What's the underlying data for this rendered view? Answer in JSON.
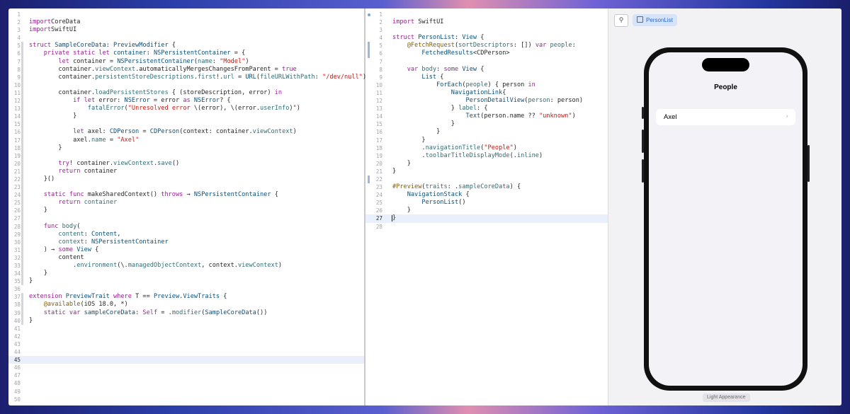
{
  "editor_left": {
    "current_line": 45,
    "lines": [
      [],
      [
        [
          "kw",
          "import"
        ],
        [
          "",
          "CoreData"
        ]
      ],
      [
        [
          "kw",
          "import"
        ],
        [
          "",
          "SwiftUI"
        ]
      ],
      [],
      [
        [
          "kw",
          "struct "
        ],
        [
          "ty",
          "SampleCoreData"
        ],
        [
          "",
          ": "
        ],
        [
          "ty",
          "PreviewModifier"
        ],
        [
          "",
          " {"
        ]
      ],
      [
        [
          "",
          "    "
        ],
        [
          "kw",
          "private static let "
        ],
        [
          "ty",
          "container"
        ],
        [
          "",
          ": "
        ],
        [
          "ty",
          "NSPersistentContainer"
        ],
        [
          "",
          " = {"
        ]
      ],
      [
        [
          "",
          "        "
        ],
        [
          "kw",
          "let "
        ],
        [
          "",
          "container = "
        ],
        [
          "ty",
          "NSPersistentContainer"
        ],
        [
          "",
          "("
        ],
        [
          "fn",
          "name"
        ],
        [
          "",
          ": "
        ],
        [
          "str",
          "\"Model\""
        ],
        [
          "",
          ")"
        ]
      ],
      [
        [
          "",
          "        container."
        ],
        [
          "fn",
          "viewContext"
        ],
        [
          "",
          ".automaticallyMergesChangesFromParent = "
        ],
        [
          "kw",
          "true"
        ]
      ],
      [
        [
          "",
          "        container."
        ],
        [
          "fn",
          "persistentStoreDescriptions"
        ],
        [
          "",
          "."
        ],
        [
          "fn",
          "first"
        ],
        [
          "",
          "!."
        ],
        [
          "fn",
          "url"
        ],
        [
          "",
          " = "
        ],
        [
          "ty",
          "URL"
        ],
        [
          "",
          "("
        ],
        [
          "fn",
          "fileURLWithPath"
        ],
        [
          "",
          ": "
        ],
        [
          "str",
          "\"/dev/null\""
        ],
        [
          "",
          ")"
        ]
      ],
      [],
      [
        [
          "",
          "        container."
        ],
        [
          "fn",
          "loadPersistentStores"
        ],
        [
          "",
          " { (storeDescription, error) "
        ],
        [
          "kw",
          "in"
        ]
      ],
      [
        [
          "",
          "            "
        ],
        [
          "kw",
          "if let "
        ],
        [
          "",
          "error: "
        ],
        [
          "ty",
          "NSError"
        ],
        [
          "",
          " = error "
        ],
        [
          "kw",
          "as "
        ],
        [
          "ty",
          "NSError"
        ],
        [
          "",
          "? {"
        ]
      ],
      [
        [
          "",
          "                "
        ],
        [
          "fn",
          "fatalError"
        ],
        [
          "",
          "("
        ],
        [
          "str",
          "\"Unresolved error "
        ],
        [
          "",
          "\\(error), \\(error."
        ],
        [
          "fn",
          "userInfo"
        ],
        [
          "",
          ")"
        ],
        [
          "str",
          "\""
        ],
        [
          "",
          ")"
        ]
      ],
      [
        [
          "",
          "            }"
        ]
      ],
      [],
      [
        [
          "",
          "            "
        ],
        [
          "kw",
          "let "
        ],
        [
          "",
          "axel: "
        ],
        [
          "ty",
          "CDPerson"
        ],
        [
          "",
          " = "
        ],
        [
          "ty",
          "CDPerson"
        ],
        [
          "",
          "(context: container."
        ],
        [
          "fn",
          "viewContext"
        ],
        [
          "",
          ")"
        ]
      ],
      [
        [
          "",
          "            axel."
        ],
        [
          "fn",
          "name"
        ],
        [
          "",
          " = "
        ],
        [
          "str",
          "\"Axel\""
        ]
      ],
      [
        [
          "",
          "        }"
        ]
      ],
      [],
      [
        [
          "",
          "        "
        ],
        [
          "kw",
          "try"
        ],
        [
          "",
          "! container."
        ],
        [
          "fn",
          "viewContext"
        ],
        [
          "",
          "."
        ],
        [
          "fn",
          "save"
        ],
        [
          "",
          "()"
        ]
      ],
      [
        [
          "",
          "        "
        ],
        [
          "kw",
          "return "
        ],
        [
          "",
          "container"
        ]
      ],
      [
        [
          "",
          "    }()"
        ]
      ],
      [],
      [
        [
          "",
          "    "
        ],
        [
          "kw",
          "static func "
        ],
        [
          "",
          "makeSharedContext() "
        ],
        [
          "kw",
          "throws"
        ],
        [
          "",
          " → "
        ],
        [
          "ty",
          "NSPersistentContainer"
        ],
        [
          "",
          " {"
        ]
      ],
      [
        [
          "",
          "        "
        ],
        [
          "kw",
          "return "
        ],
        [
          "fn",
          "container"
        ]
      ],
      [
        [
          "",
          "    }"
        ]
      ],
      [],
      [
        [
          "",
          "    "
        ],
        [
          "kw",
          "func "
        ],
        [
          "fn",
          "body"
        ],
        [
          "",
          "("
        ]
      ],
      [
        [
          "",
          "        "
        ],
        [
          "fn",
          "content"
        ],
        [
          "",
          ": "
        ],
        [
          "ty",
          "Content"
        ],
        [
          "",
          ","
        ]
      ],
      [
        [
          "",
          "        "
        ],
        [
          "fn",
          "context"
        ],
        [
          "",
          ": "
        ],
        [
          "ty",
          "NSPersistentContainer"
        ]
      ],
      [
        [
          "",
          "    ) → "
        ],
        [
          "kw",
          "some "
        ],
        [
          "ty",
          "View"
        ],
        [
          "",
          " {"
        ]
      ],
      [
        [
          "",
          "        content"
        ]
      ],
      [
        [
          "",
          "            ."
        ],
        [
          "fn",
          "environment"
        ],
        [
          "",
          "(\\."
        ],
        [
          "fn",
          "managedObjectContext"
        ],
        [
          "",
          ", context."
        ],
        [
          "fn",
          "viewContext"
        ],
        [
          "",
          ")"
        ]
      ],
      [
        [
          "",
          "    }"
        ]
      ],
      [
        [
          "",
          "}"
        ]
      ],
      [],
      [
        [
          "kw",
          "extension "
        ],
        [
          "ty",
          "PreviewTrait "
        ],
        [
          "kw",
          "where "
        ],
        [
          "",
          "T == "
        ],
        [
          "ty",
          "Preview"
        ],
        [
          "",
          "."
        ],
        [
          "ty",
          "ViewTraits"
        ],
        [
          "",
          " {"
        ]
      ],
      [
        [
          "",
          "    "
        ],
        [
          "attr",
          "@available"
        ],
        [
          "",
          "(iOS 18.0, *)"
        ]
      ],
      [
        [
          "",
          "    "
        ],
        [
          "kw",
          "static var "
        ],
        [
          "ty",
          "sampleCoreData"
        ],
        [
          "",
          ": "
        ],
        [
          "kw",
          "Self"
        ],
        [
          "",
          " = ."
        ],
        [
          "fn",
          "modifier"
        ],
        [
          "",
          "("
        ],
        [
          "ty",
          "SampleCoreData"
        ],
        [
          "",
          "())"
        ]
      ],
      [
        [
          "",
          "}"
        ]
      ],
      [],
      [],
      [],
      [],
      [],
      [],
      [],
      [],
      [],
      []
    ]
  },
  "editor_mid": {
    "current_line": 27,
    "lines": [
      [],
      [
        [
          "kw",
          "import "
        ],
        [
          "",
          "SwiftUI"
        ]
      ],
      [],
      [
        [
          "kw",
          "struct "
        ],
        [
          "ty",
          "PersonList"
        ],
        [
          "",
          ": "
        ],
        [
          "ty",
          "View"
        ],
        [
          "",
          " {"
        ]
      ],
      [
        [
          "",
          "    "
        ],
        [
          "attr",
          "@FetchRequest"
        ],
        [
          "",
          "("
        ],
        [
          "fn",
          "sortDescriptors"
        ],
        [
          "",
          ": []) "
        ],
        [
          "kw",
          "var "
        ],
        [
          "fn",
          "people"
        ],
        [
          "",
          ":"
        ]
      ],
      [
        [
          "",
          "        "
        ],
        [
          "ty",
          "FetchedResults"
        ],
        [
          "",
          "<CDPerson>"
        ]
      ],
      [],
      [
        [
          "",
          "    "
        ],
        [
          "kw",
          "var "
        ],
        [
          "fn",
          "body"
        ],
        [
          "",
          ": "
        ],
        [
          "kw",
          "some "
        ],
        [
          "ty",
          "View"
        ],
        [
          "",
          " {"
        ]
      ],
      [
        [
          "",
          "        "
        ],
        [
          "ty",
          "List"
        ],
        [
          "",
          " {"
        ]
      ],
      [
        [
          "",
          "            "
        ],
        [
          "ty",
          "ForEach"
        ],
        [
          "",
          "("
        ],
        [
          "fn",
          "people"
        ],
        [
          "",
          ") { person "
        ],
        [
          "kw",
          "in"
        ]
      ],
      [
        [
          "",
          "                "
        ],
        [
          "ty",
          "NavigationLink"
        ],
        [
          "",
          "{"
        ]
      ],
      [
        [
          "",
          "                    "
        ],
        [
          "ty",
          "PersonDetailView"
        ],
        [
          "",
          "("
        ],
        [
          "fn",
          "person"
        ],
        [
          "",
          ": person)"
        ]
      ],
      [
        [
          "",
          "                } "
        ],
        [
          "fn",
          "label"
        ],
        [
          "",
          ": {"
        ]
      ],
      [
        [
          "",
          "                    "
        ],
        [
          "ty",
          "Text"
        ],
        [
          "",
          "(person.name ?? "
        ],
        [
          "str",
          "\"unknown\""
        ],
        [
          "",
          ")"
        ]
      ],
      [
        [
          "",
          "                }"
        ]
      ],
      [
        [
          "",
          "            }"
        ]
      ],
      [
        [
          "",
          "        }"
        ]
      ],
      [
        [
          "",
          "        ."
        ],
        [
          "fn",
          "navigationTitle"
        ],
        [
          "",
          "("
        ],
        [
          "str",
          "\"People\""
        ],
        [
          "",
          ")"
        ]
      ],
      [
        [
          "",
          "        ."
        ],
        [
          "fn",
          "toolbarTitleDisplayMode"
        ],
        [
          "",
          "(."
        ],
        [
          "fn",
          "inline"
        ],
        [
          "",
          ")"
        ]
      ],
      [
        [
          "",
          "    }"
        ]
      ],
      [
        [
          "",
          "}"
        ]
      ],
      [],
      [
        [
          "attr",
          "#Preview"
        ],
        [
          "",
          "("
        ],
        [
          "fn",
          "traits"
        ],
        [
          "",
          ": ."
        ],
        [
          "fn",
          "sampleCoreData"
        ],
        [
          "",
          ") {"
        ]
      ],
      [
        [
          "",
          "    "
        ],
        [
          "ty",
          "NavigationStack"
        ],
        [
          "",
          " {"
        ]
      ],
      [
        [
          "",
          "        "
        ],
        [
          "ty",
          "PersonList"
        ],
        [
          "",
          "()"
        ]
      ],
      [
        [
          "",
          "    }"
        ]
      ],
      [
        [
          "",
          "}"
        ]
      ],
      []
    ]
  },
  "preview": {
    "pin_icon": "pin-icon",
    "chip_label": "PersonList",
    "nav_title": "People",
    "rows": [
      "Axel"
    ],
    "appearance_label": "Light Appearance"
  }
}
